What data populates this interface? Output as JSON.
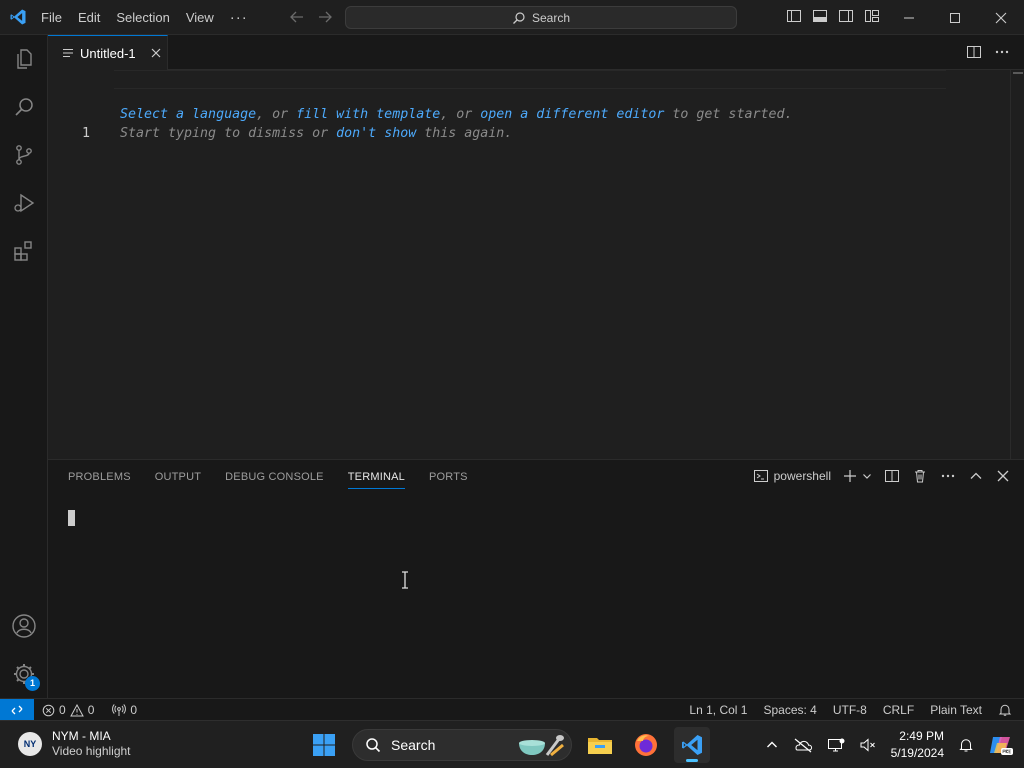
{
  "titlebar": {
    "menu": [
      "File",
      "Edit",
      "Selection",
      "View",
      "···"
    ],
    "search_label": "Search"
  },
  "editor": {
    "tab_label": "Untitled-1",
    "line_number": "1",
    "hint_line1": {
      "link1": "Select a language",
      "text1": ", or ",
      "link2": "fill with template",
      "text2": ", or ",
      "link3": "open a different editor",
      "text3": " to get started."
    },
    "hint_line2": {
      "text1": "Start typing to dismiss or ",
      "link1": "don't show",
      "text2": " this again."
    }
  },
  "panel": {
    "tabs": [
      "PROBLEMS",
      "OUTPUT",
      "DEBUG CONSOLE",
      "TERMINAL",
      "PORTS"
    ],
    "active_tab": "TERMINAL",
    "shell_label": "powershell"
  },
  "statusbar": {
    "errors": "0",
    "warnings": "0",
    "ports": "0",
    "position": "Ln 1, Col 1",
    "spaces": "Spaces: 4",
    "encoding": "UTF-8",
    "eol": "CRLF",
    "language": "Plain Text"
  },
  "activitybar": {
    "accounts_badge": "1"
  },
  "taskbar": {
    "news_title": "NYM - MIA",
    "news_subtitle": "Video highlight",
    "search_label": "Search",
    "time": "2:49 PM",
    "date": "5/19/2024"
  },
  "colors": {
    "accent": "#0078d4",
    "link": "#4daafc",
    "background": "#1f1f1f"
  }
}
